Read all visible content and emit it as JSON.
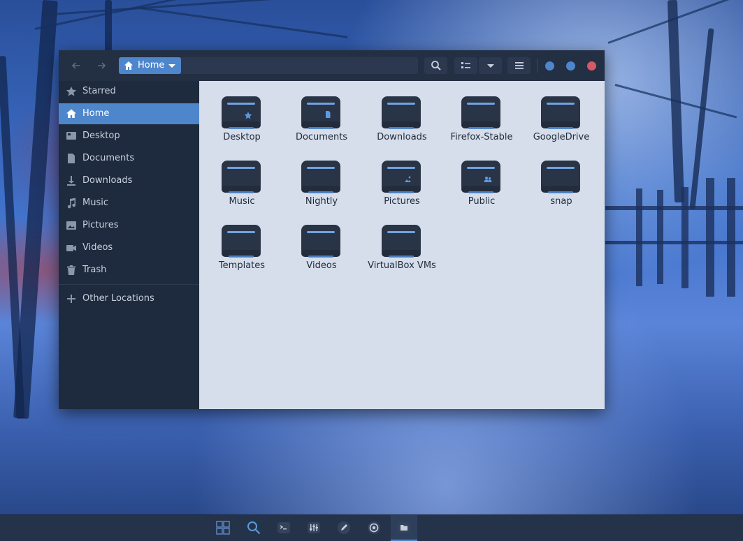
{
  "colors": {
    "accent": "#4e86cc",
    "sidebar_bg": "#1e2a3d",
    "headerbar_bg": "#232f43",
    "content_bg": "#d5deea",
    "folder_body": "#2a3447",
    "close_dot": "#d55a66",
    "window_dots": "#4e86cc"
  },
  "headerbar": {
    "back_icon": "arrow-left-icon",
    "forward_icon": "arrow-right-icon",
    "path_label": "Home",
    "buttons": [
      "search-icon",
      "list-view-icon",
      "chevron-down-icon",
      "hamburger-menu-icon"
    ]
  },
  "sidebar": {
    "items": [
      {
        "label": "Starred",
        "icon": "star-icon"
      },
      {
        "label": "Home",
        "icon": "home-icon"
      },
      {
        "label": "Desktop",
        "icon": "desktop-icon"
      },
      {
        "label": "Documents",
        "icon": "document-icon"
      },
      {
        "label": "Downloads",
        "icon": "download-icon"
      },
      {
        "label": "Music",
        "icon": "music-icon"
      },
      {
        "label": "Pictures",
        "icon": "picture-icon"
      },
      {
        "label": "Videos",
        "icon": "video-icon"
      },
      {
        "label": "Trash",
        "icon": "trash-icon"
      }
    ],
    "other_locations": "Other Locations"
  },
  "folders": [
    {
      "label": "Desktop",
      "emblem": "star"
    },
    {
      "label": "Documents",
      "emblem": "document"
    },
    {
      "label": "Downloads",
      "emblem": ""
    },
    {
      "label": "Firefox-Stable",
      "emblem": ""
    },
    {
      "label": "GoogleDrive",
      "emblem": ""
    },
    {
      "label": "Music",
      "emblem": ""
    },
    {
      "label": "Nightly",
      "emblem": ""
    },
    {
      "label": "Pictures",
      "emblem": "picture"
    },
    {
      "label": "Public",
      "emblem": "people"
    },
    {
      "label": "snap",
      "emblem": ""
    },
    {
      "label": "Templates",
      "emblem": ""
    },
    {
      "label": "Videos",
      "emblem": ""
    },
    {
      "label": "VirtualBox VMs",
      "emblem": ""
    }
  ],
  "taskbar": {
    "icons": [
      "app-grid-icon",
      "search-icon",
      "terminal-icon",
      "mixer-icon",
      "pen-icon",
      "chrome-icon",
      "files-icon"
    ],
    "active": "files-icon"
  }
}
